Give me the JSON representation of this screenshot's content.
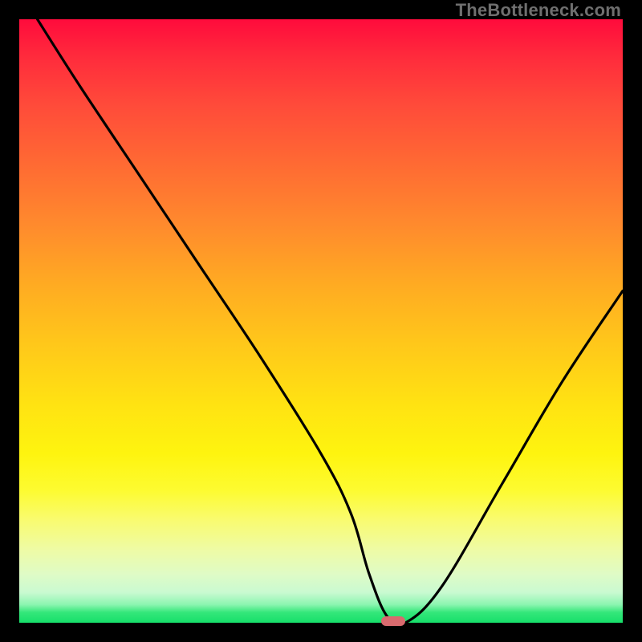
{
  "watermark": "TheBottleneck.com",
  "chart_data": {
    "type": "line",
    "title": "",
    "xlabel": "",
    "ylabel": "",
    "xlim": [
      0,
      100
    ],
    "ylim": [
      0,
      100
    ],
    "grid": false,
    "legend": false,
    "series": [
      {
        "name": "bottleneck-curve",
        "x": [
          3,
          10,
          20,
          30,
          40,
          50,
          55,
          58,
          61,
          64,
          70,
          80,
          90,
          100
        ],
        "y": [
          100,
          89,
          74,
          59,
          44,
          28,
          18,
          8,
          1,
          0,
          6,
          23,
          40,
          55
        ]
      }
    ],
    "marker": {
      "x": 62,
      "y": 0,
      "color": "#d86a6e"
    },
    "background_gradient": {
      "top": "#ff0b3c",
      "mid": "#ffe312",
      "bottom": "#16df6a"
    }
  }
}
